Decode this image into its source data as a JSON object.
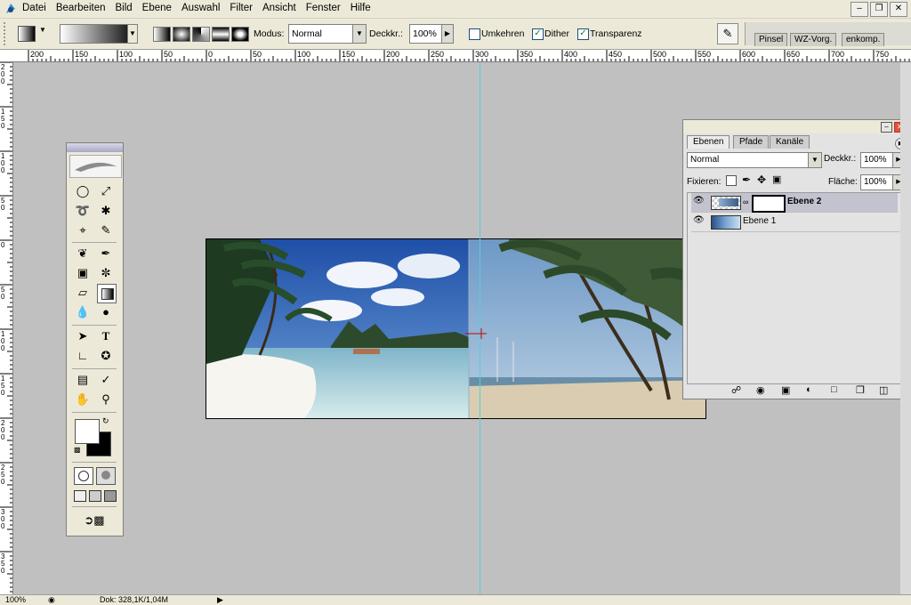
{
  "menubar": {
    "items": [
      "Datei",
      "Bearbeiten",
      "Bild",
      "Ebene",
      "Auswahl",
      "Filter",
      "Ansicht",
      "Fenster",
      "Hilfe"
    ]
  },
  "options": {
    "mode_label": "Modus:",
    "mode_value": "Normal",
    "opacity_label": "Deckkr.:",
    "opacity_value": "100%",
    "reverse_label": "Umkehren",
    "reverse_checked": false,
    "dither_label": "Dither",
    "dither_checked": true,
    "transparency_label": "Transparenz",
    "transparency_checked": true,
    "palette_tabs": [
      "Pinsel",
      "WZ-Vorg.",
      "enkomp."
    ]
  },
  "ruler": {
    "h_labels": [
      "200",
      "150",
      "100",
      "50",
      "0",
      "50",
      "100",
      "150",
      "200",
      "250",
      "300",
      "350",
      "400",
      "450",
      "500",
      "550",
      "600",
      "650",
      "700",
      "750"
    ],
    "v_labels": [
      "200",
      "150",
      "100",
      "50",
      "0",
      "50",
      "100",
      "150",
      "200",
      "250",
      "300",
      "350"
    ]
  },
  "layers_panel": {
    "tabs": [
      "Ebenen",
      "Pfade",
      "Kanäle"
    ],
    "blend_mode": "Normal",
    "opacity_label": "Deckkr.:",
    "opacity_value": "100%",
    "lock_label": "Fixieren:",
    "fill_label": "Fläche:",
    "fill_value": "100%",
    "layers": [
      {
        "name": "Ebene 2",
        "selected": true
      },
      {
        "name": "Ebene 1",
        "selected": false
      }
    ]
  },
  "status": {
    "zoom": "100%",
    "doc": "Dok: 328,1K/1,04M"
  },
  "colors": {
    "guide": "#4fd1d9",
    "canvas_bg": "#c0c0c0",
    "selected_layer": "#c3c3cf"
  }
}
